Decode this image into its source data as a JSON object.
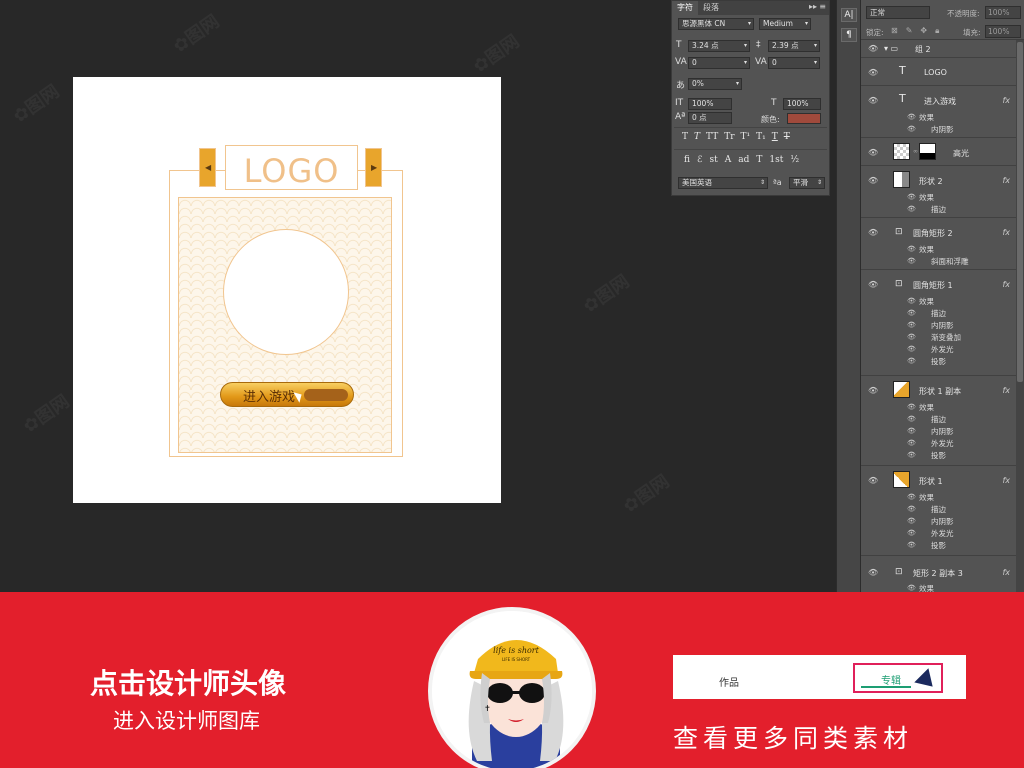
{
  "canvas": {
    "logo_text": "LOGO",
    "button_label": "进入游戏",
    "left_arrow": "◀",
    "right_arrow": "▶"
  },
  "character_panel": {
    "tabs": [
      "字符",
      "段落"
    ],
    "font_family": "思源黑体 CN",
    "font_style": "Medium",
    "font_size": "3.24 点",
    "leading": "2.39 点",
    "kerning": "0",
    "tracking": "0",
    "scale_ratio": "0%",
    "vertical_scale": "100%",
    "horizontal_scale": "100%",
    "baseline_shift": "0 点",
    "color_label": "颜色:",
    "color_swatch": "#a04a3c",
    "style_buttons": [
      "T",
      "T",
      "TT",
      "Tr",
      "T¹",
      "T₁",
      "T",
      "T"
    ],
    "ot_buttons": [
      "fi",
      "ℰ",
      "st",
      "A",
      "ad",
      "T",
      "1st",
      "½"
    ],
    "language": "美国英语",
    "aa_label": "ªa",
    "aa_method": "平滑"
  },
  "tool_strip": {
    "buttons": [
      "A|",
      "¶"
    ]
  },
  "layers_panel": {
    "blend_mode": "正常",
    "opacity_label": "不透明度:",
    "opacity_value": "100%",
    "lock_label": "锁定:",
    "fill_label": "填充:",
    "fill_value": "100%",
    "group_name": "组 2",
    "fx": "fx",
    "effects_label": "效果",
    "layers": [
      {
        "name": "LOGO"
      },
      {
        "name": "进入游戏",
        "effects": [
          "内阴影"
        ]
      },
      {
        "name": "高光"
      },
      {
        "name": "形状 2",
        "effects": [
          "描边"
        ]
      },
      {
        "name": "圆角矩形 2",
        "effects": [
          "斜面和浮雕"
        ]
      },
      {
        "name": "圆角矩形 1",
        "effects": [
          "描边",
          "内阴影",
          "渐变叠加",
          "外发光",
          "投影"
        ]
      },
      {
        "name": "形状 1 副本",
        "effects": [
          "描边",
          "内阴影",
          "外发光",
          "投影"
        ]
      },
      {
        "name": "形状 1",
        "effects": [
          "描边",
          "内阴影",
          "外发光",
          "投影"
        ]
      },
      {
        "name": "矩形 2 副本 3",
        "effects": [
          "效果"
        ]
      }
    ]
  },
  "banner": {
    "title": "点击设计师头像",
    "subtitle": "进入设计师图库",
    "tab_works": "作品",
    "tab_album": "专辑",
    "more_text": "查看更多同类素材",
    "cap_text": "life is short",
    "cap_subtext": "LIFE IS SHORT"
  }
}
